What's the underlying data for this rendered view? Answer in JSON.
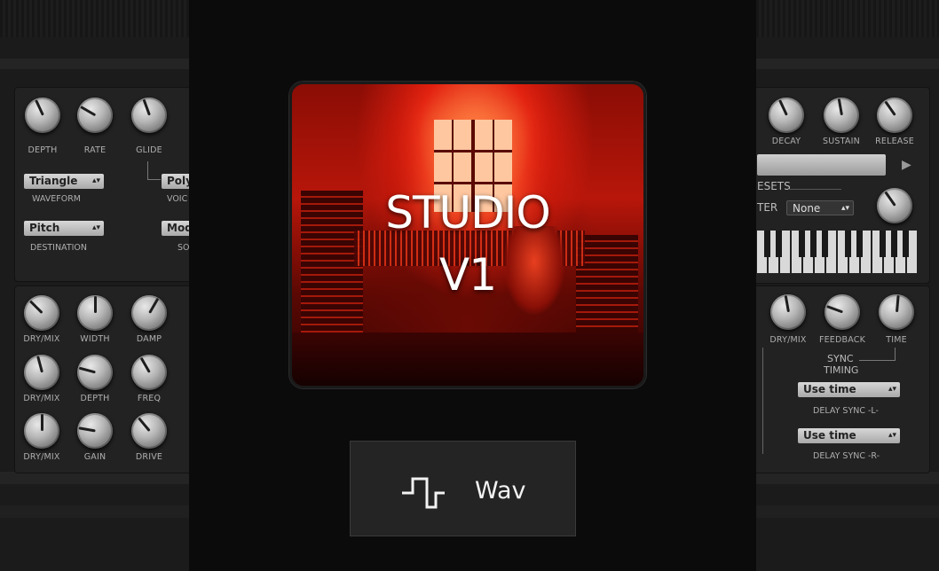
{
  "left": {
    "mod_knobs": [
      {
        "name": "knob-depth",
        "label": "DEPTH",
        "angle": -25
      },
      {
        "name": "knob-rate",
        "label": "RATE",
        "angle": -60
      },
      {
        "name": "knob-glide",
        "label": "GLIDE",
        "angle": -20
      }
    ],
    "waveform": {
      "value": "Triangle",
      "label": "WAVEFORM"
    },
    "destination": {
      "value": "Pitch",
      "label": "DESTINATION"
    },
    "voice": {
      "value": "Poly",
      "label": "VOIC"
    },
    "source": {
      "value": "Mod",
      "label": "SO"
    },
    "fx_rows": [
      [
        {
          "name": "knob-reverb-drymix",
          "label": "DRY/MIX",
          "angle": -45
        },
        {
          "name": "knob-width",
          "label": "WIDTH",
          "angle": 0
        },
        {
          "name": "knob-damp",
          "label": "DAMP",
          "angle": 30
        }
      ],
      [
        {
          "name": "knob-chorus-drymix",
          "label": "DRY/MIX",
          "angle": -15
        },
        {
          "name": "knob-depth-2",
          "label": "DEPTH",
          "angle": -75
        },
        {
          "name": "knob-freq",
          "label": "FREQ",
          "angle": -30
        }
      ],
      [
        {
          "name": "knob-dist-drymix",
          "label": "DRY/MIX",
          "angle": 0
        },
        {
          "name": "knob-gain",
          "label": "GAIN",
          "angle": -80
        },
        {
          "name": "knob-drive",
          "label": "DRIVE",
          "angle": -40
        }
      ]
    ]
  },
  "right": {
    "env_knobs": [
      {
        "name": "knob-decay",
        "label": "DECAY",
        "angle": -25
      },
      {
        "name": "knob-sustain",
        "label": "SUSTAIN",
        "angle": -10
      },
      {
        "name": "knob-release",
        "label": "RELEASE",
        "angle": -35
      }
    ],
    "presets_label": "ESETS",
    "filter_label": "TER",
    "filter_select": "None",
    "delay_knobs": [
      {
        "name": "knob-delay-drymix",
        "label": "DRY/MIX",
        "angle": -10
      },
      {
        "name": "knob-feedback",
        "label": "FEEDBACK",
        "angle": -70
      },
      {
        "name": "knob-time",
        "label": "TIME",
        "angle": 5
      }
    ],
    "sync_label": "SYNC",
    "timing_label": "TIMING",
    "delay_sync_l": {
      "value": "Use time",
      "label": "DELAY SYNC -L-"
    },
    "delay_sync_r": {
      "value": "Use time",
      "label": "DELAY SYNC -R-"
    }
  },
  "artwork": {
    "title_line1": "STUDIO",
    "title_line2": "V1"
  },
  "wav_button": {
    "label": "Wav",
    "icon": "square-wave-icon"
  },
  "colors": {
    "accent": "#d41a0c",
    "panel": "#222222",
    "overlay": "#0b0b0b"
  }
}
